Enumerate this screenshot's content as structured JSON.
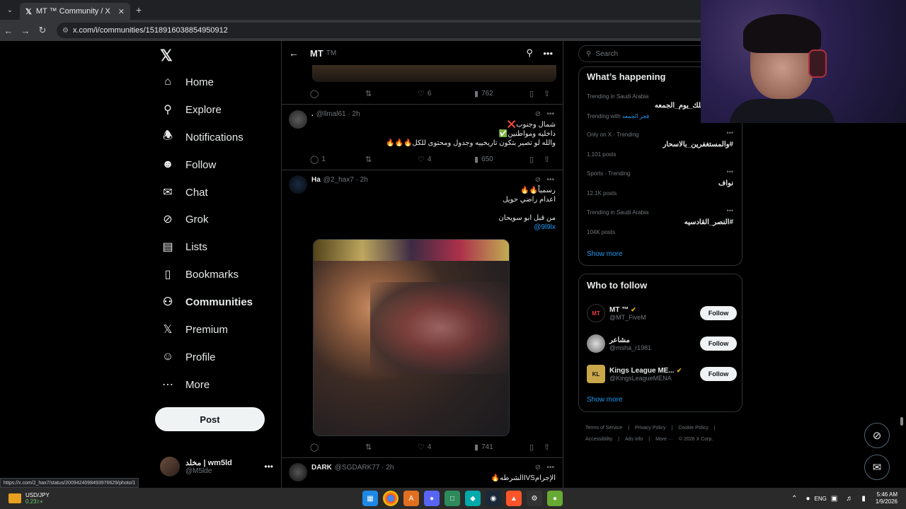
{
  "browser": {
    "tab_title": "MT ™ Community / X",
    "tab_favicon": "x-logo-icon",
    "url": "x.com/i/communities/1518916038854950912"
  },
  "nav": {
    "items": [
      {
        "label": "Home",
        "icon": "home-icon"
      },
      {
        "label": "Explore",
        "icon": "search-icon"
      },
      {
        "label": "Notifications",
        "icon": "bell-icon"
      },
      {
        "label": "Follow",
        "icon": "person-plus-icon"
      },
      {
        "label": "Chat",
        "icon": "mail-icon"
      },
      {
        "label": "Grok",
        "icon": "grok-icon"
      },
      {
        "label": "Lists",
        "icon": "list-icon"
      },
      {
        "label": "Bookmarks",
        "icon": "bookmark-icon"
      },
      {
        "label": "Communities",
        "icon": "communities-icon"
      },
      {
        "label": "Premium",
        "icon": "x-logo-icon"
      },
      {
        "label": "Profile",
        "icon": "person-icon"
      },
      {
        "label": "More",
        "icon": "more-circle-icon"
      }
    ],
    "post_label": "Post",
    "account": {
      "name": "مخلد | wm5ld",
      "handle": "@M5lde"
    }
  },
  "header": {
    "title": "MT",
    "suffix": "TM"
  },
  "tweets": [
    {
      "replies": "",
      "reposts": "",
      "likes": "6",
      "views": "762"
    },
    {
      "name": ".",
      "handle": "@llmal61",
      "time": "2h",
      "lines": [
        "شمال وجنوب❌",
        "داخليه ومواطنين✅",
        "والله لو تصير بتكون تاريخييه وجدول ومحتوى للكل🔥🔥🔥"
      ],
      "replies": "1",
      "reposts": "",
      "likes": "4",
      "views": "650"
    },
    {
      "name": "Ha",
      "handle": "@2_hax7",
      "time": "2h",
      "lines": [
        "رسمياً🔥🔥",
        "اعدام راضي حويل",
        "",
        "من قبل ابو سويحان"
      ],
      "link": "@9l9lx",
      "replies": "",
      "reposts": "",
      "likes": "4",
      "views": "741"
    },
    {
      "name": "DARK",
      "handle": "@SGDARK77",
      "time": "2h",
      "lines": [
        "الإجرامIVSالشرطه🔥"
      ]
    }
  ],
  "right": {
    "search_placeholder": "Search",
    "happening_title": "What’s happening",
    "trends": [
      {
        "meta": "Trending in Saudi Arabia",
        "title": "ك_وعن_اهلك_يوم_الجمعه",
        "extra_label": "Trending with",
        "extra_link": "فجر الجمعه"
      },
      {
        "meta": "Only on X · Trending",
        "title": "#والمستغفرين_بالاسحار",
        "count": "1,101 posts"
      },
      {
        "meta": "Sports · Trending",
        "title": "نواف",
        "count": "12.1K posts"
      },
      {
        "meta": "Trending in Saudi Arabia",
        "title": "#النصر_القادسيه",
        "count": "104K posts"
      }
    ],
    "show_more": "Show more",
    "wtf_title": "Who to follow",
    "wtf": [
      {
        "name": "MT ™",
        "handle": "@MT_FiveM",
        "avatar_text": "MT",
        "follow": "Follow"
      },
      {
        "name": "مشاعر",
        "handle": "@msha_r1981",
        "avatar_text": "",
        "follow": "Follow"
      },
      {
        "name": "Kings League ME...",
        "handle": "@KingsLeagueMENA",
        "avatar_text": "KL",
        "follow": "Follow"
      }
    ],
    "wtf_show_more": "Show more",
    "footer": [
      "Terms of Service",
      "|",
      "Privacy Policy",
      "|",
      "Cookie Policy",
      "|",
      "Accessibility",
      "|",
      "Ads info",
      "|",
      "More ···",
      "© 2026 X Corp."
    ]
  },
  "status_url": "https://x.com/2_hax7/status/2009424098493976629/photo/1",
  "taskbar": {
    "weather_l1": "USD/JPY",
    "weather_l2": "0.23٪+",
    "lang": "ENG",
    "time": "5:46 AM",
    "date": "1/9/2026"
  },
  "colors": {
    "accent": "#1d9bf0",
    "bg": "#000000",
    "border": "#2f3336",
    "muted": "#71767b"
  }
}
